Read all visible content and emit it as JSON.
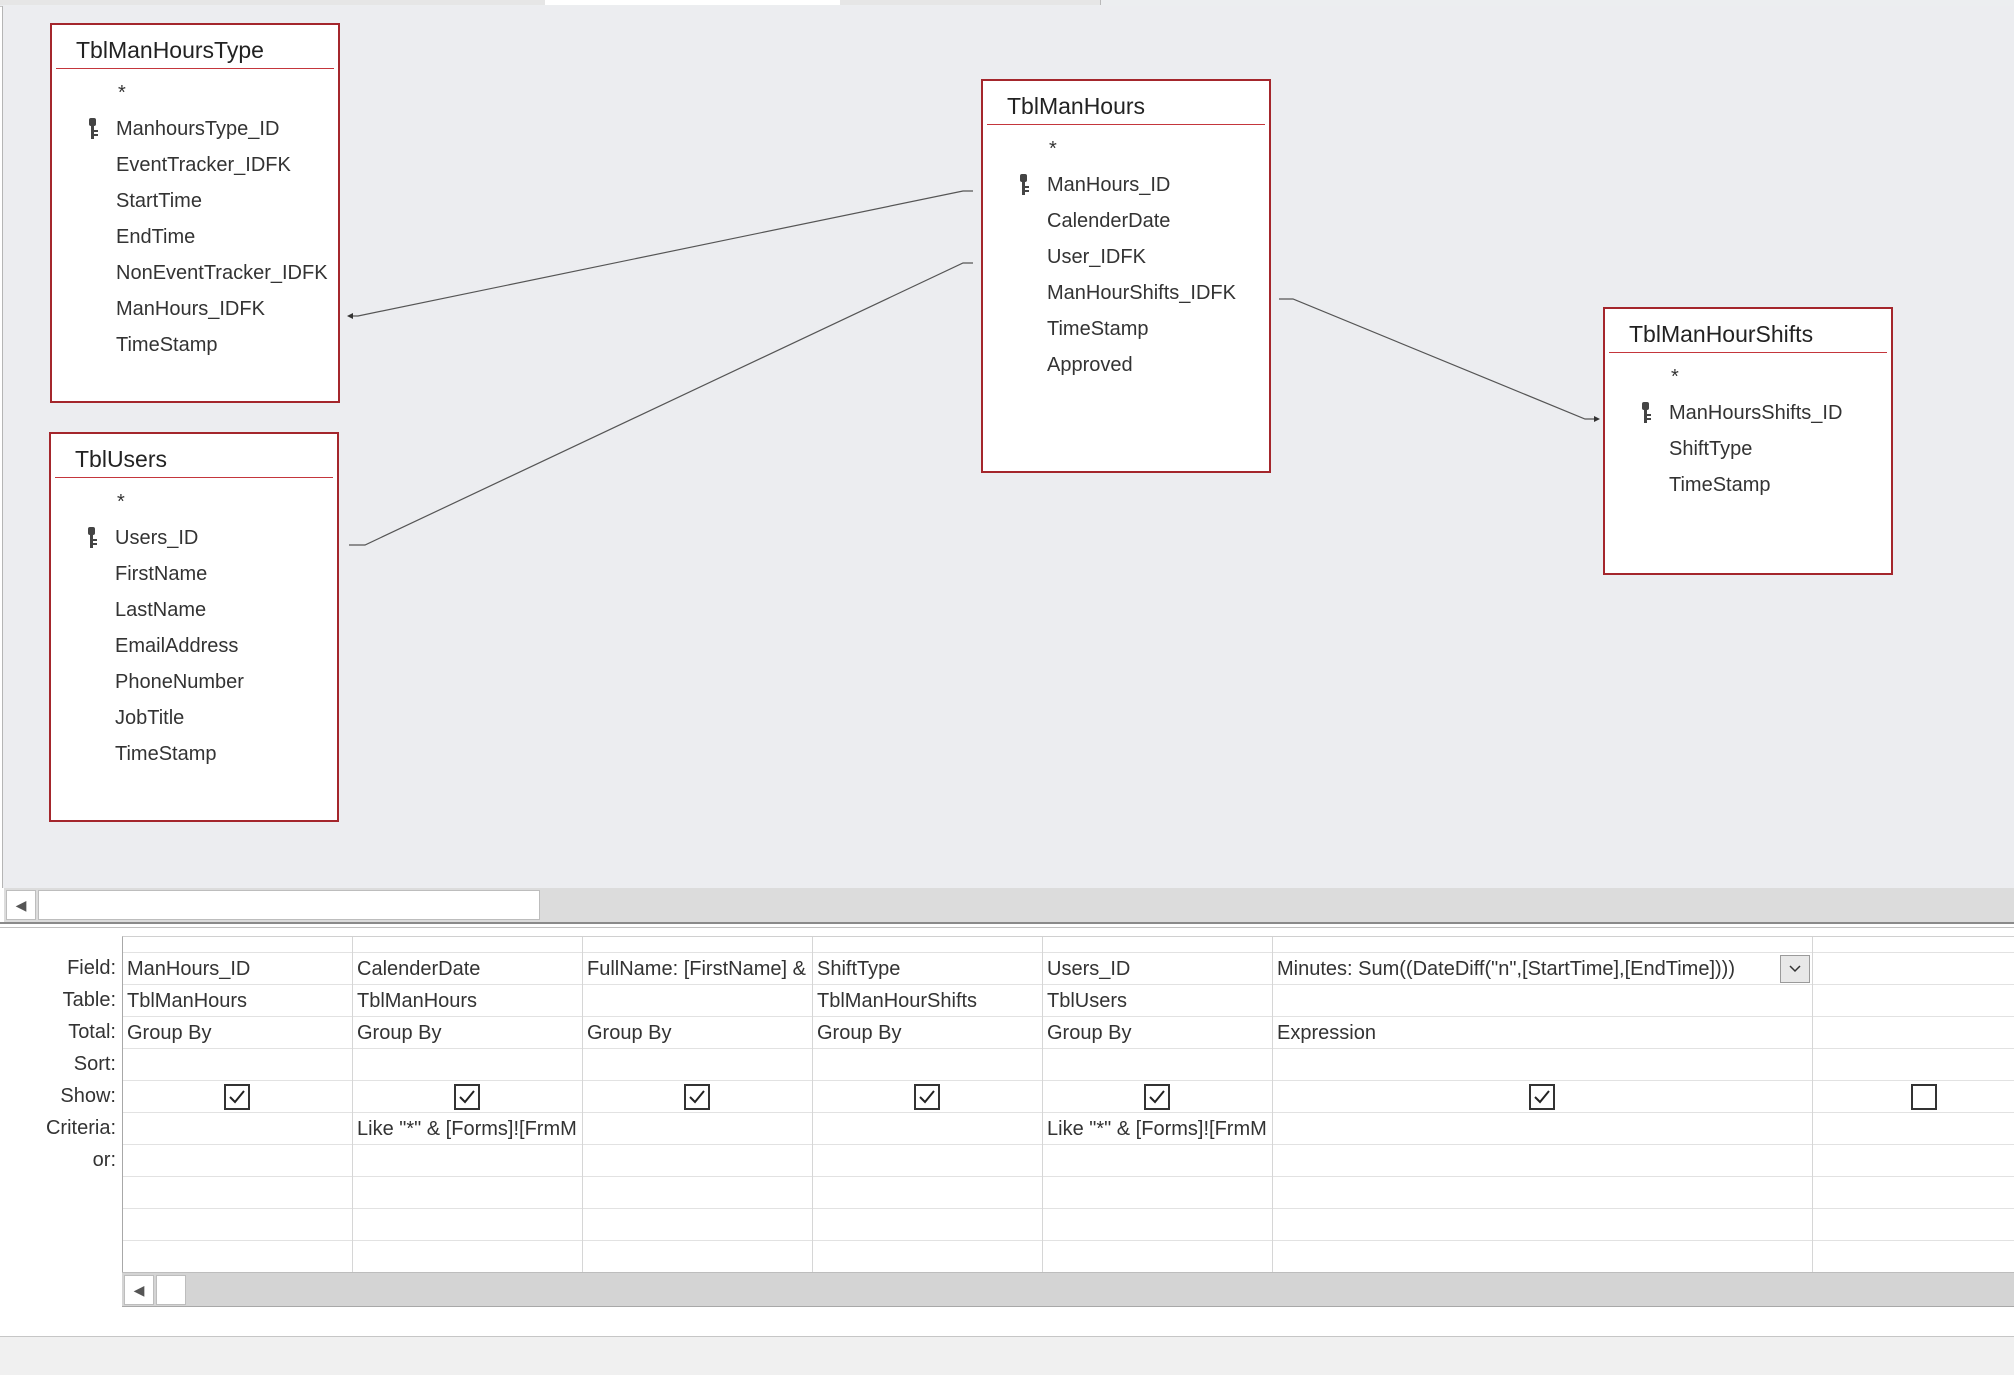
{
  "tables": {
    "manhourstype": {
      "title": "TblManHoursType",
      "fields": [
        "*",
        "ManhoursType_ID",
        "EventTracker_IDFK",
        "StartTime",
        "EndTime",
        "NonEventTracker_IDFK",
        "ManHours_IDFK",
        "TimeStamp"
      ]
    },
    "users": {
      "title": "TblUsers",
      "fields": [
        "*",
        "Users_ID",
        "FirstName",
        "LastName",
        "EmailAddress",
        "PhoneNumber",
        "JobTitle",
        "TimeStamp"
      ]
    },
    "manhours": {
      "title": "TblManHours",
      "fields": [
        "*",
        "ManHours_ID",
        "CalenderDate",
        "User_IDFK",
        "ManHourShifts_IDFK",
        "TimeStamp",
        "Approved"
      ]
    },
    "manhourshifts": {
      "title": "TblManHourShifts",
      "fields": [
        "*",
        "ManHoursShifts_ID",
        "ShiftType",
        "TimeStamp"
      ]
    }
  },
  "grid": {
    "row_labels": [
      "Field:",
      "Table:",
      "Total:",
      "Sort:",
      "Show:",
      "Criteria:",
      "or:"
    ],
    "columns": [
      {
        "field": "ManHours_ID",
        "table": "TblManHours",
        "total": "Group By",
        "sort": "",
        "show": true,
        "criteria": "",
        "or": ""
      },
      {
        "field": "CalenderDate",
        "table": "TblManHours",
        "total": "Group By",
        "sort": "",
        "show": true,
        "criteria": "Like \"*\" & [Forms]![FrmM",
        "or": ""
      },
      {
        "field": "FullName: [FirstName] & \" \"",
        "table": "",
        "total": "Group By",
        "sort": "",
        "show": true,
        "criteria": "",
        "or": ""
      },
      {
        "field": "ShiftType",
        "table": "TblManHourShifts",
        "total": "Group By",
        "sort": "",
        "show": true,
        "criteria": "",
        "or": ""
      },
      {
        "field": "Users_ID",
        "table": "TblUsers",
        "total": "Group By",
        "sort": "",
        "show": true,
        "criteria": "Like \"*\" & [Forms]![FrmM",
        "or": ""
      },
      {
        "field": "Minutes: Sum((DateDiff(\"n\",[StartTime],[EndTime])))",
        "table": "",
        "total": "Expression",
        "sort": "",
        "show": true,
        "criteria": "",
        "or": ""
      },
      {
        "field": "",
        "table": "",
        "total": "",
        "sort": "",
        "show": false,
        "criteria": "",
        "or": ""
      }
    ]
  },
  "colors": {
    "table_border": "#a4262c",
    "surface": "#ecedf0"
  }
}
